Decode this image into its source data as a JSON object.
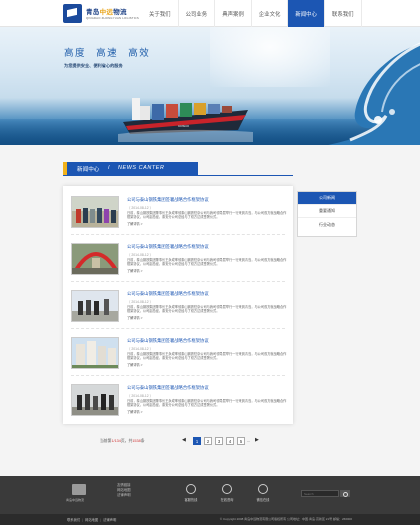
{
  "header": {
    "logo_cn_part1": "青岛",
    "logo_cn_part2": "中远",
    "logo_cn_part3": "物流",
    "logo_en": "QINGDAO ZHONGYUAN LOGISTICS",
    "nav": [
      "关于我们",
      "公司业务",
      "典声案例",
      "企业文化",
      "新闻中心",
      "联系我们"
    ],
    "active_nav": "新闻中心"
  },
  "banner": {
    "headline": "高度  高速  高效",
    "subline": "为您提供安全、便利省心的服务"
  },
  "news_section": {
    "title": "新闻中心",
    "separator": "/",
    "title_en": "NEWS CANTER"
  },
  "news": [
    {
      "title": "公司与泰山钢铁集团签署战略合作框架协议",
      "date": "（ 2014-08-12 ）",
      "desc": "日前，泰山钢铁集团董事长王永成率领泰山钢铁驻京公司与我司领导层举行一行来到青岛，与公司双方就战略合作框架协议，公司副总经，泰安分公司总经与了双方达成签署仪式。",
      "more": "了解详情 >"
    },
    {
      "title": "公司与泰山钢铁集团签署战略合作框架协议",
      "date": "（ 2014-08-12 ）",
      "desc": "日前，泰山钢铁集团董事长王永成率领泰山钢铁驻京公司与我司领导层举行一行来到青岛，与公司双方就战略合作框架协议，公司副总经，泰安分公司总经与了双方达成签署仪式。",
      "more": "了解详情 >"
    },
    {
      "title": "公司与泰山钢铁集团签署战略合作框架协议",
      "date": "（ 2014-08-12 ）",
      "desc": "日前，泰山钢铁集团董事长王永成率领泰山钢铁驻京公司与我司领导层举行一行来到青岛，与公司双方就战略合作框架协议，公司副总经，泰安分公司总经与了双方达成签署仪式。",
      "more": "了解详情 >"
    },
    {
      "title": "公司与泰山钢铁集团签署战略合作框架协议",
      "date": "（ 2014-08-12 ）",
      "desc": "日前，泰山钢铁集团董事长王永成率领泰山钢铁驻京公司与我司领导层举行一行来到青岛，与公司双方就战略合作框架协议，公司副总经，泰安分公司总经与了双方达成签署仪式。",
      "more": "了解详情 >"
    },
    {
      "title": "公司与泰山钢铁集团签署战略合作框架协议",
      "date": "（ 2014-08-12 ）",
      "desc": "日前，泰山钢铁集团董事长王永成率领泰山钢铁驻京公司与我司领导层举行一行来到青岛，与公司双方就战略合作框架协议，公司副总经，泰安分公司总经与了双方达成签署仪式。",
      "more": "了解详情 >"
    }
  ],
  "side_menu": [
    "公司新闻",
    "重要通知",
    "行业动态"
  ],
  "side_menu_active": "公司新闻",
  "pager": {
    "label_current": "当前第",
    "current": "1",
    "total_pages": "/134",
    "label_page": "页，共",
    "total_items": "1538",
    "label_items": "条",
    "prev": "◀",
    "pages": [
      "1",
      "2",
      "3",
      "4",
      "5"
    ],
    "dots": "...",
    "next": "▶"
  },
  "footer": {
    "logo_text": "青岛中远物流",
    "links": [
      "友情链接",
      "网站地图",
      "法律声明"
    ],
    "icons": [
      {
        "name": "phone-icon",
        "label": "客服热线"
      },
      {
        "name": "globe-icon",
        "label": "在线咨询"
      },
      {
        "name": "chat-icon",
        "label": "微信在线"
      }
    ],
    "search_placeholder": "Search"
  },
  "bottom": {
    "links": [
      "联系我们",
      "网站地图",
      "法律声明"
    ],
    "copyright": "© Copyright 2008 青岛中远物流有限公司版权所有 公司地址：中国·青岛·高新区 21号  邮编：266000"
  }
}
